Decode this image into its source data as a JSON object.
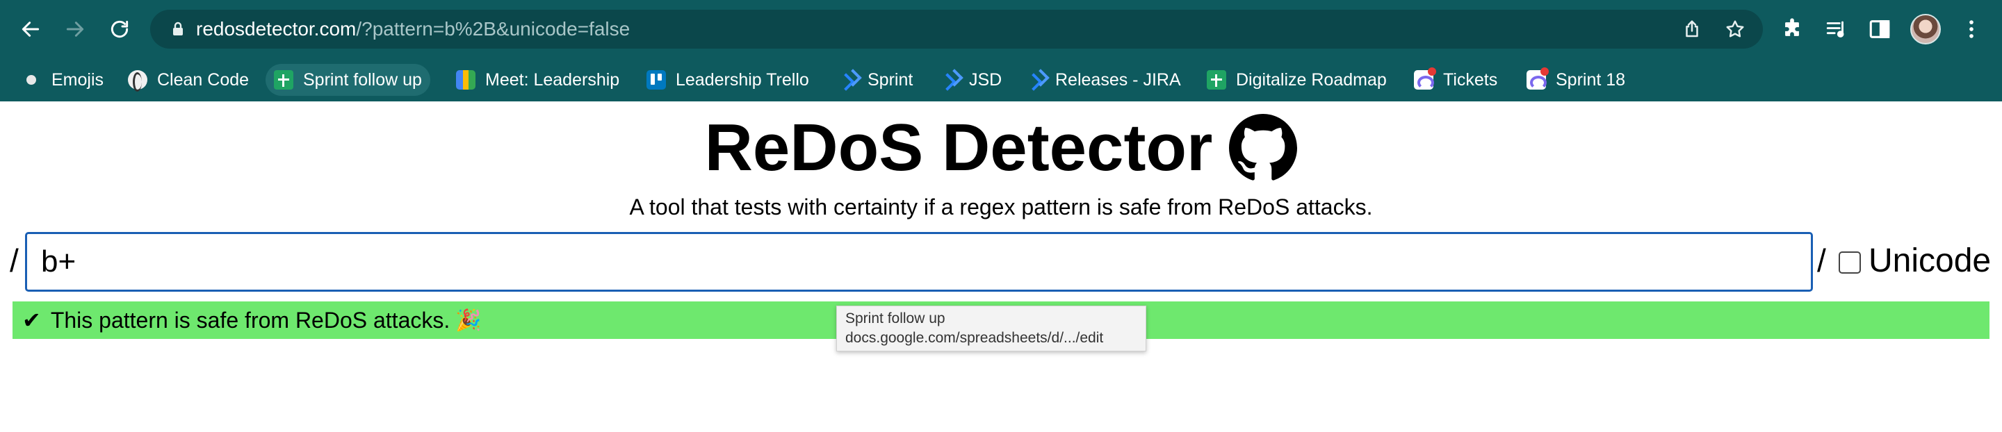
{
  "browser": {
    "url_host": "redosdetector.com",
    "url_rest": "/?pattern=b%2B&unicode=false",
    "icons": [
      "back-icon",
      "forward-icon",
      "reload-icon",
      "lock-icon",
      "share-icon",
      "star-icon",
      "extensions-icon",
      "media-icon",
      "side-panel-icon",
      "menu-icon"
    ]
  },
  "bookmarks": [
    {
      "label": "Emojis",
      "icon": "dot"
    },
    {
      "label": "Clean Code",
      "icon": "cleancode"
    },
    {
      "label": "Sprint follow up",
      "icon": "sheet"
    },
    {
      "label": "Meet: Leadership",
      "icon": "meet"
    },
    {
      "label": "Leadership Trello",
      "icon": "trello"
    },
    {
      "label": "Sprint",
      "icon": "jira"
    },
    {
      "label": "JSD",
      "icon": "jira"
    },
    {
      "label": "Releases - JIRA",
      "icon": "jira"
    },
    {
      "label": "Digitalize Roadmap",
      "icon": "sheet"
    },
    {
      "label": "Tickets",
      "icon": "clickup"
    },
    {
      "label": "Sprint 18",
      "icon": "clickup"
    }
  ],
  "page": {
    "title": "ReDoS Detector",
    "subtitle": "A tool that tests with certainty if a regex pattern is safe from ReDoS attacks.",
    "slash_open": "/",
    "slash_close": "/",
    "pattern_value": "b+",
    "unicode_checked": false,
    "unicode_label": "Unicode",
    "result_check": "✔",
    "result_text": "This pattern is safe from ReDoS attacks.",
    "result_emoji": "🎉",
    "result_color": "#6ee86e"
  },
  "tooltip": {
    "title": "Sprint follow up",
    "url": "docs.google.com/spreadsheets/d/.../edit"
  }
}
